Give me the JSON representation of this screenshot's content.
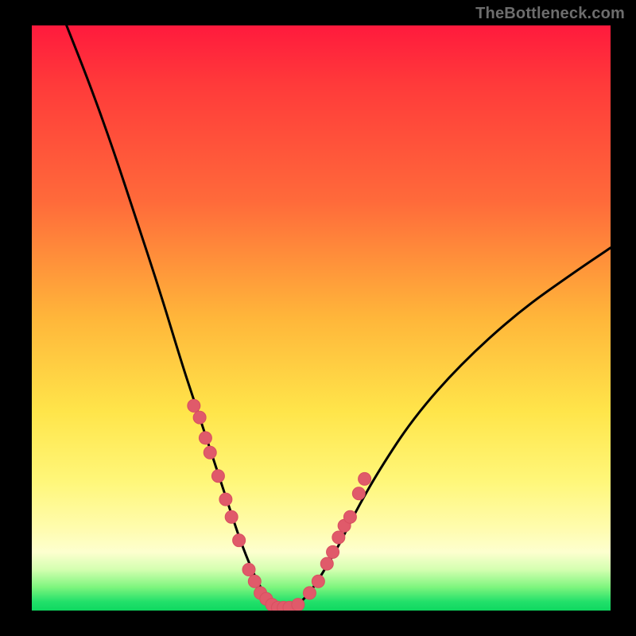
{
  "watermark": "TheBottleneck.com",
  "colors": {
    "frame": "#000000",
    "dot": "#e05a6a",
    "curve": "#000000",
    "gradient_top": "#ff1a3d",
    "gradient_bottom": "#0fd860"
  },
  "chart_data": {
    "type": "line",
    "title": "",
    "xlabel": "",
    "ylabel": "",
    "xlim": [
      0,
      100
    ],
    "ylim": [
      0,
      100
    ],
    "grid": false,
    "legend": false,
    "annotations": [
      "TheBottleneck.com"
    ],
    "series": [
      {
        "name": "left-curve",
        "x": [
          6,
          10,
          14,
          18,
          22,
          26,
          28,
          30,
          32,
          34,
          36,
          38,
          40,
          42,
          44
        ],
        "y": [
          100,
          90,
          79,
          67,
          55,
          42,
          36,
          30,
          24,
          18,
          12,
          7,
          3,
          1,
          0
        ]
      },
      {
        "name": "right-curve",
        "x": [
          44,
          46,
          48,
          50,
          53,
          56,
          60,
          66,
          74,
          84,
          94,
          100
        ],
        "y": [
          0,
          1,
          3,
          6,
          11,
          17,
          24,
          33,
          42,
          51,
          58,
          62
        ]
      }
    ],
    "scatter_points": {
      "name": "dots",
      "x": [
        28.0,
        29.0,
        30.0,
        30.8,
        32.2,
        33.5,
        34.5,
        35.8,
        37.5,
        38.5,
        39.5,
        40.5,
        41.5,
        42.5,
        43.5,
        44.5,
        46.0,
        48.0,
        49.5,
        51.0,
        52.0,
        53.0,
        54.0,
        55.0,
        56.5,
        57.5
      ],
      "y": [
        35.0,
        33.0,
        29.5,
        27.0,
        23.0,
        19.0,
        16.0,
        12.0,
        7.0,
        5.0,
        3.0,
        2.0,
        1.0,
        0.5,
        0.5,
        0.5,
        1.0,
        3.0,
        5.0,
        8.0,
        10.0,
        12.5,
        14.5,
        16.0,
        20.0,
        22.5
      ]
    }
  }
}
